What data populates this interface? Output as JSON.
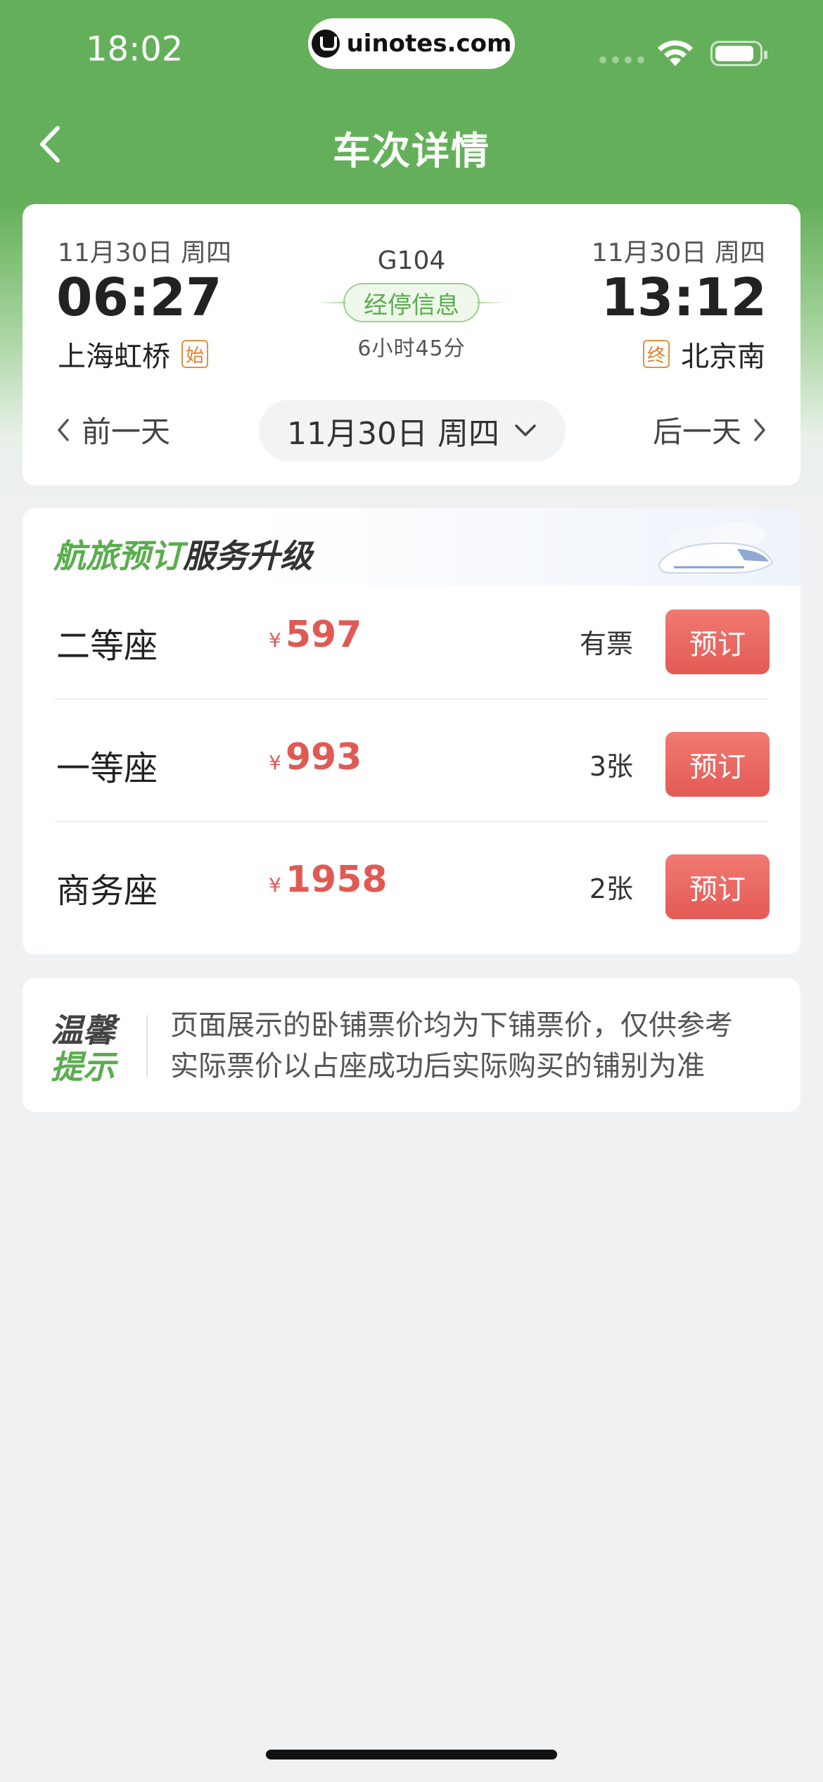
{
  "status_bar": {
    "time": "18:02",
    "url": "uinotes.com"
  },
  "nav": {
    "title": "车次详情"
  },
  "trip": {
    "depart_date": "11月30日 周四",
    "depart_time": "06:27",
    "depart_station": "上海虹桥",
    "depart_tag": "始",
    "train_no": "G104",
    "stop_info": "经停信息",
    "duration": "6小时45分",
    "arrive_date": "11月30日 周四",
    "arrive_time": "13:12",
    "arrive_station": "北京南",
    "arrive_tag": "终"
  },
  "date_nav": {
    "prev": "前一天",
    "current": "11月30日 周四",
    "next": "后一天"
  },
  "promo": {
    "green": "航旅预订",
    "dark": "服务升级"
  },
  "seats": [
    {
      "name": "二等座",
      "currency": "¥",
      "price": "597",
      "availability": "有票",
      "button": "预订"
    },
    {
      "name": "一等座",
      "currency": "¥",
      "price": "993",
      "availability": "3张",
      "button": "预订"
    },
    {
      "name": "商务座",
      "currency": "¥",
      "price": "1958",
      "availability": "2张",
      "button": "预订"
    }
  ],
  "notice": {
    "label_top": "温馨",
    "label_bottom": "提示",
    "line1": "页面展示的卧铺票价均为下铺票价，仅供参考",
    "line2": "实际票价以占座成功后实际购买的铺别为准"
  },
  "colors": {
    "brand_green": "#64b05a",
    "price_red": "#e05a54",
    "button_red": "#e45a55"
  }
}
